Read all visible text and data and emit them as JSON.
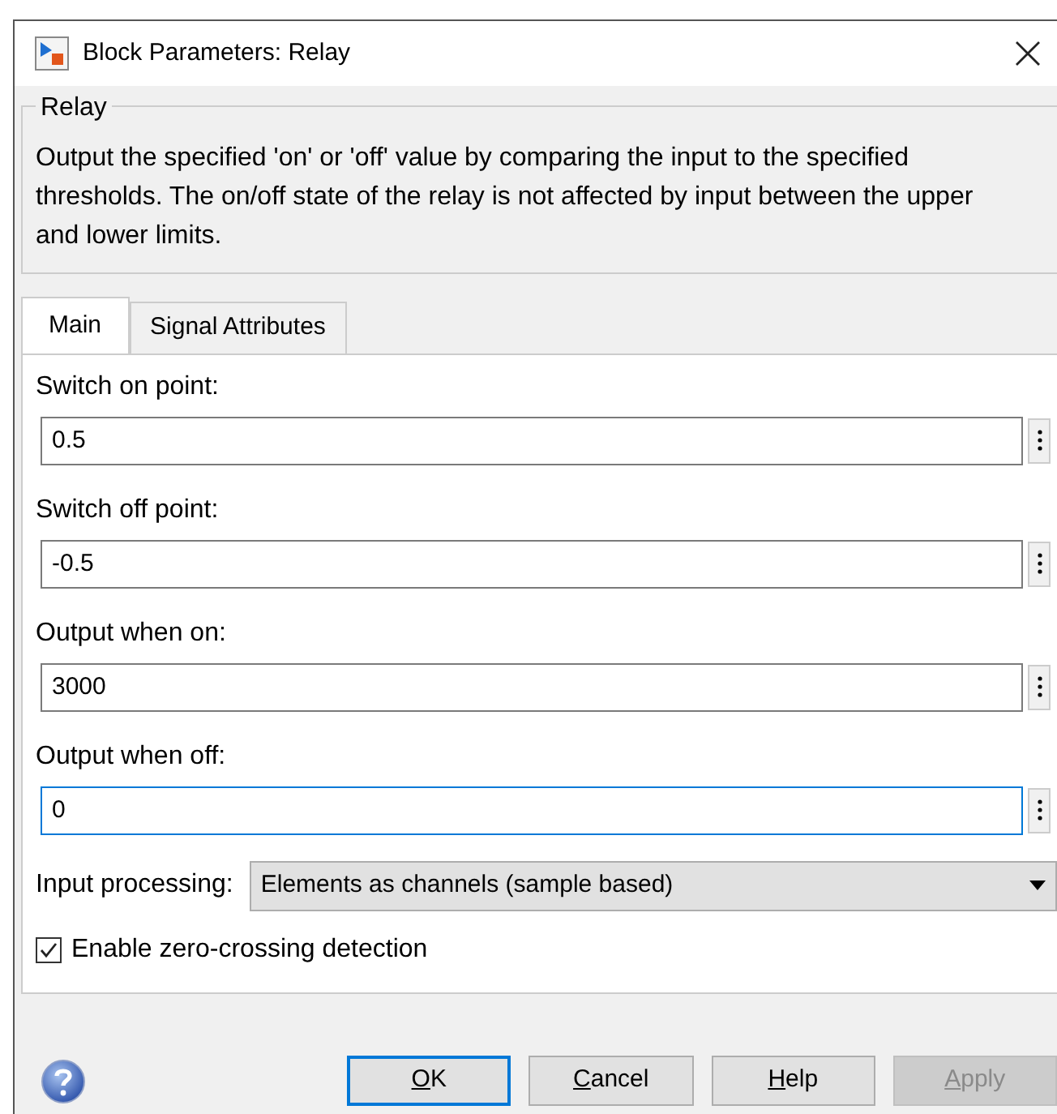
{
  "window": {
    "title": "Block Parameters: Relay"
  },
  "group": {
    "title": "Relay",
    "description": "Output the specified 'on' or 'off' value by comparing the input to the specified thresholds.  The on/off state of the relay is not affected by input between the upper and lower limits."
  },
  "tabs": [
    {
      "label": "Main",
      "selected": true
    },
    {
      "label": "Signal Attributes",
      "selected": false
    }
  ],
  "parameters": [
    {
      "label": "Switch on point:",
      "value": "0.5",
      "focused": false
    },
    {
      "label": "Switch off point:",
      "value": "-0.5",
      "focused": false
    },
    {
      "label": "Output when on:",
      "value": "3000",
      "focused": false
    },
    {
      "label": "Output when off:",
      "value": "0",
      "focused": true
    }
  ],
  "input_processing": {
    "label": "Input processing:",
    "value": "Elements as channels (sample based)"
  },
  "checkbox": {
    "label": "Enable zero-crossing detection",
    "checked": true
  },
  "buttons": [
    {
      "mnemonic": "O",
      "rest": "K",
      "default": true,
      "disabled": false
    },
    {
      "mnemonic": "C",
      "rest": "ancel",
      "default": false,
      "disabled": false
    },
    {
      "mnemonic": "H",
      "rest": "elp",
      "default": false,
      "disabled": false
    },
    {
      "mnemonic": "A",
      "rest": "pply",
      "default": false,
      "disabled": true
    }
  ]
}
